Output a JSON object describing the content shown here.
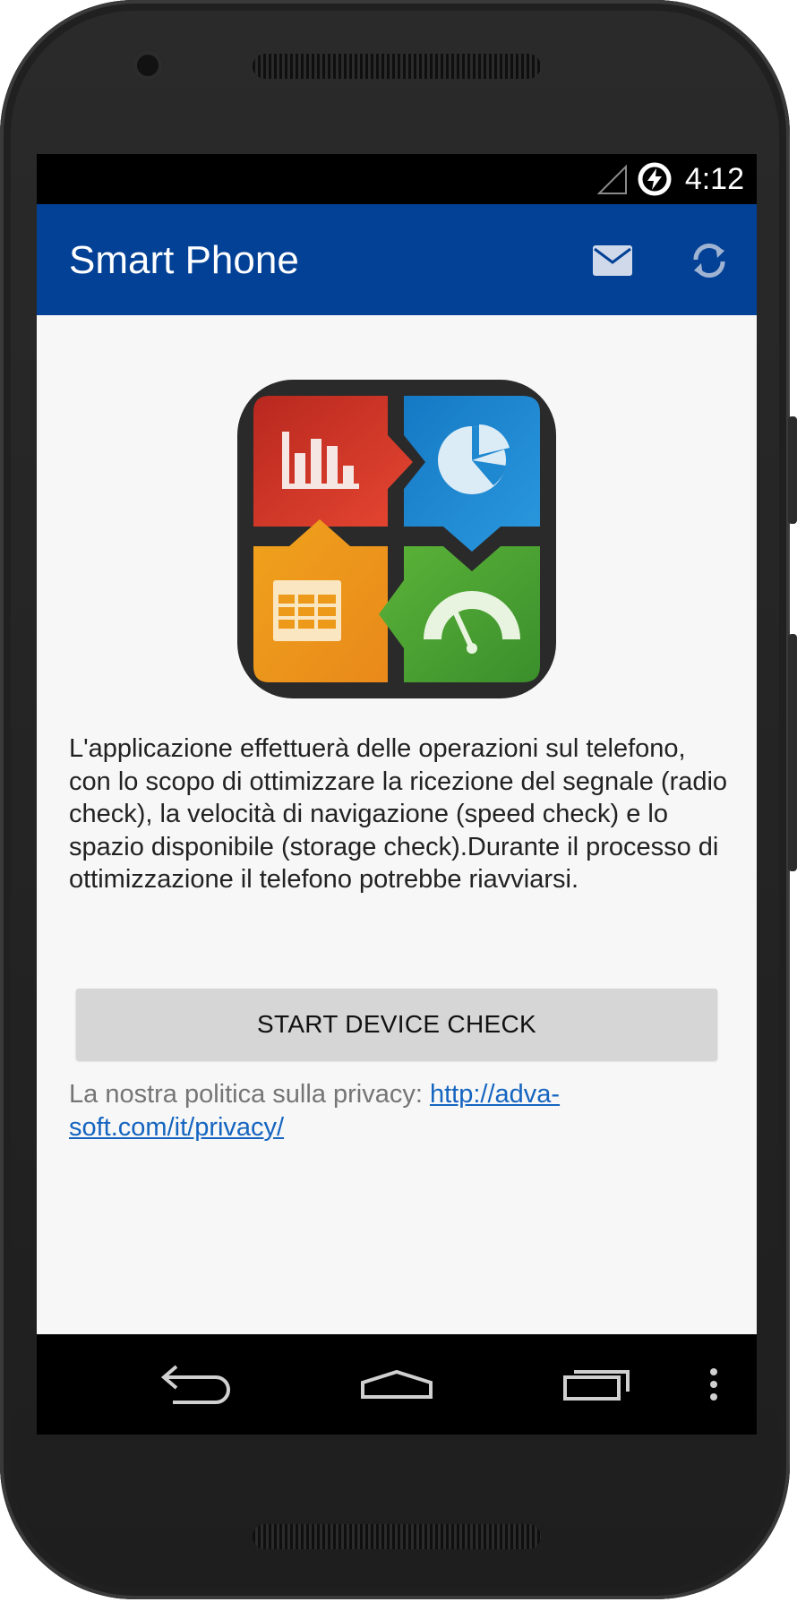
{
  "status_bar": {
    "time": "4:12"
  },
  "app_bar": {
    "title": "Smart Phone",
    "mail_icon": "mail-icon",
    "refresh_icon": "refresh-icon"
  },
  "main": {
    "logo_icon": "app-logo-icon",
    "description": "L'applicazione effettuerà delle operazioni sul telefono, con lo scopo di ottimizzare la ricezione del segnale (radio check), la velocità di navigazione (speed check) e lo spazio disponibile (storage check).Durante il processo di ottimizzazione il telefono potrebbe riavviarsi.",
    "start_button_label": "START DEVICE CHECK",
    "privacy_label": "La nostra politica sulla privacy: ",
    "privacy_link": "http://adva-soft.com/it/privacy/"
  },
  "fab": {
    "icon": "envelope-icon"
  },
  "nav_bar": {
    "back_icon": "back-icon",
    "home_icon": "home-icon",
    "recents_icon": "recents-icon",
    "menu_icon": "overflow-menu-icon"
  },
  "colors": {
    "app_bar": "#034196",
    "fab": "#1a75d2",
    "link": "#1565c0",
    "button": "#d6d6d6",
    "screen_bg": "#f7f7f7"
  }
}
